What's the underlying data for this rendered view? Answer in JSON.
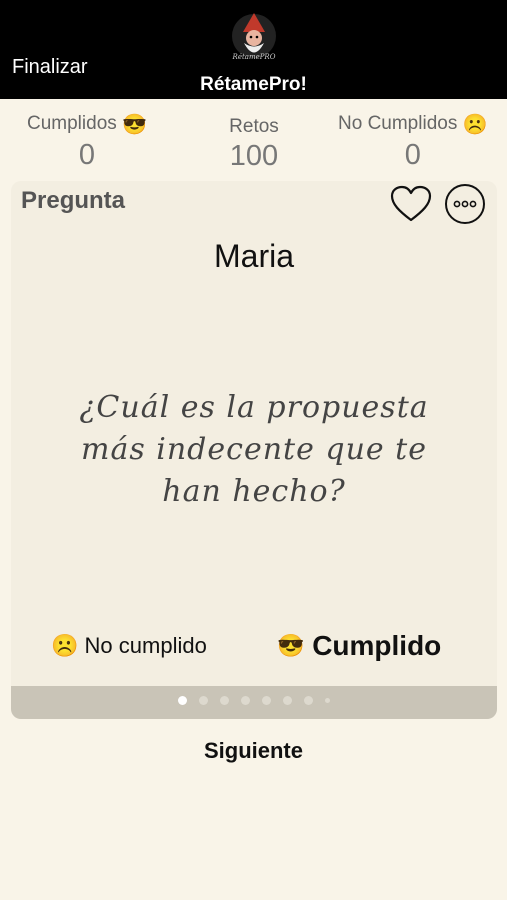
{
  "header": {
    "finish_label": "Finalizar",
    "app_title": "RétamePro!",
    "logo_text": "RétamePRO"
  },
  "stats": {
    "completed": {
      "label": "Cumplidos",
      "emoji": "😎",
      "value": "0"
    },
    "challenges": {
      "label": "Retos",
      "value": "100"
    },
    "not_completed": {
      "label": "No Cumplidos",
      "emoji": "☹️",
      "value": "0"
    }
  },
  "card": {
    "heading": "Pregunta",
    "player_name": "Maria",
    "question_line1": "¿Cuál es la propuesta",
    "question_line2": "más indecente que te",
    "question_line3": "han hecho?",
    "not_done": {
      "emoji": "☹️",
      "label": "No cumplido"
    },
    "done": {
      "emoji": "😎",
      "label": "Cumplido"
    },
    "pager": {
      "pages": 8,
      "active_index": 0
    }
  },
  "footer": {
    "next_label": "Siguiente"
  },
  "colors": {
    "background": "#f9f4e8",
    "card": "#f3eee1",
    "header": "#000000",
    "pager_strip": "#c9c4b7"
  },
  "icons": [
    "heart-icon",
    "more-options-icon",
    "gnome-logo"
  ]
}
